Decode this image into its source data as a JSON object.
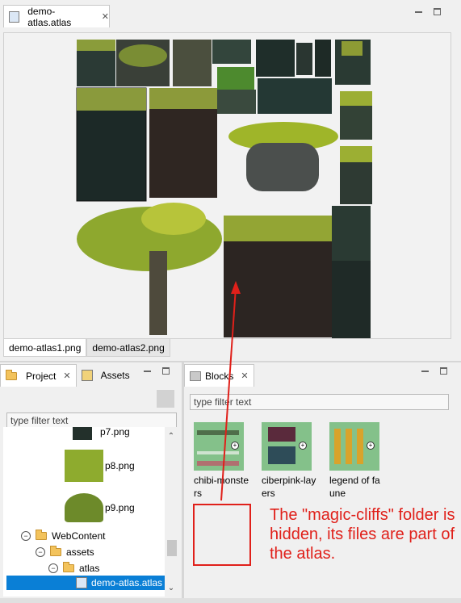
{
  "editor": {
    "tab_title": "demo-atlas.atlas",
    "image_tabs": [
      "demo-atlas1.png",
      "demo-atlas2.png"
    ]
  },
  "project_panel": {
    "tabs": [
      "Project",
      "Assets"
    ],
    "filter_placeholder": "type filter text",
    "tree": [
      {
        "label": "p7.png",
        "level": "image"
      },
      {
        "label": "p8.png",
        "level": "image"
      },
      {
        "label": "p9.png",
        "level": "image"
      },
      {
        "label": "WebContent",
        "level": "folder",
        "expanded": true
      },
      {
        "label": "assets",
        "level": "folder",
        "expanded": true
      },
      {
        "label": "atlas",
        "level": "folder",
        "expanded": true
      },
      {
        "label": "demo-atlas.atlas",
        "level": "file",
        "selected": true
      }
    ]
  },
  "blocks_panel": {
    "tab": "Blocks",
    "filter_placeholder": "type filter text",
    "blocks": [
      {
        "label": "chibi-monsters"
      },
      {
        "label": "ciberpink-layers"
      },
      {
        "label": "legend of fa une"
      }
    ]
  },
  "annotation": {
    "text": "The \"magic-cliffs\" folder is hidden, its files are part of the atlas.",
    "color": "#e0201a"
  }
}
